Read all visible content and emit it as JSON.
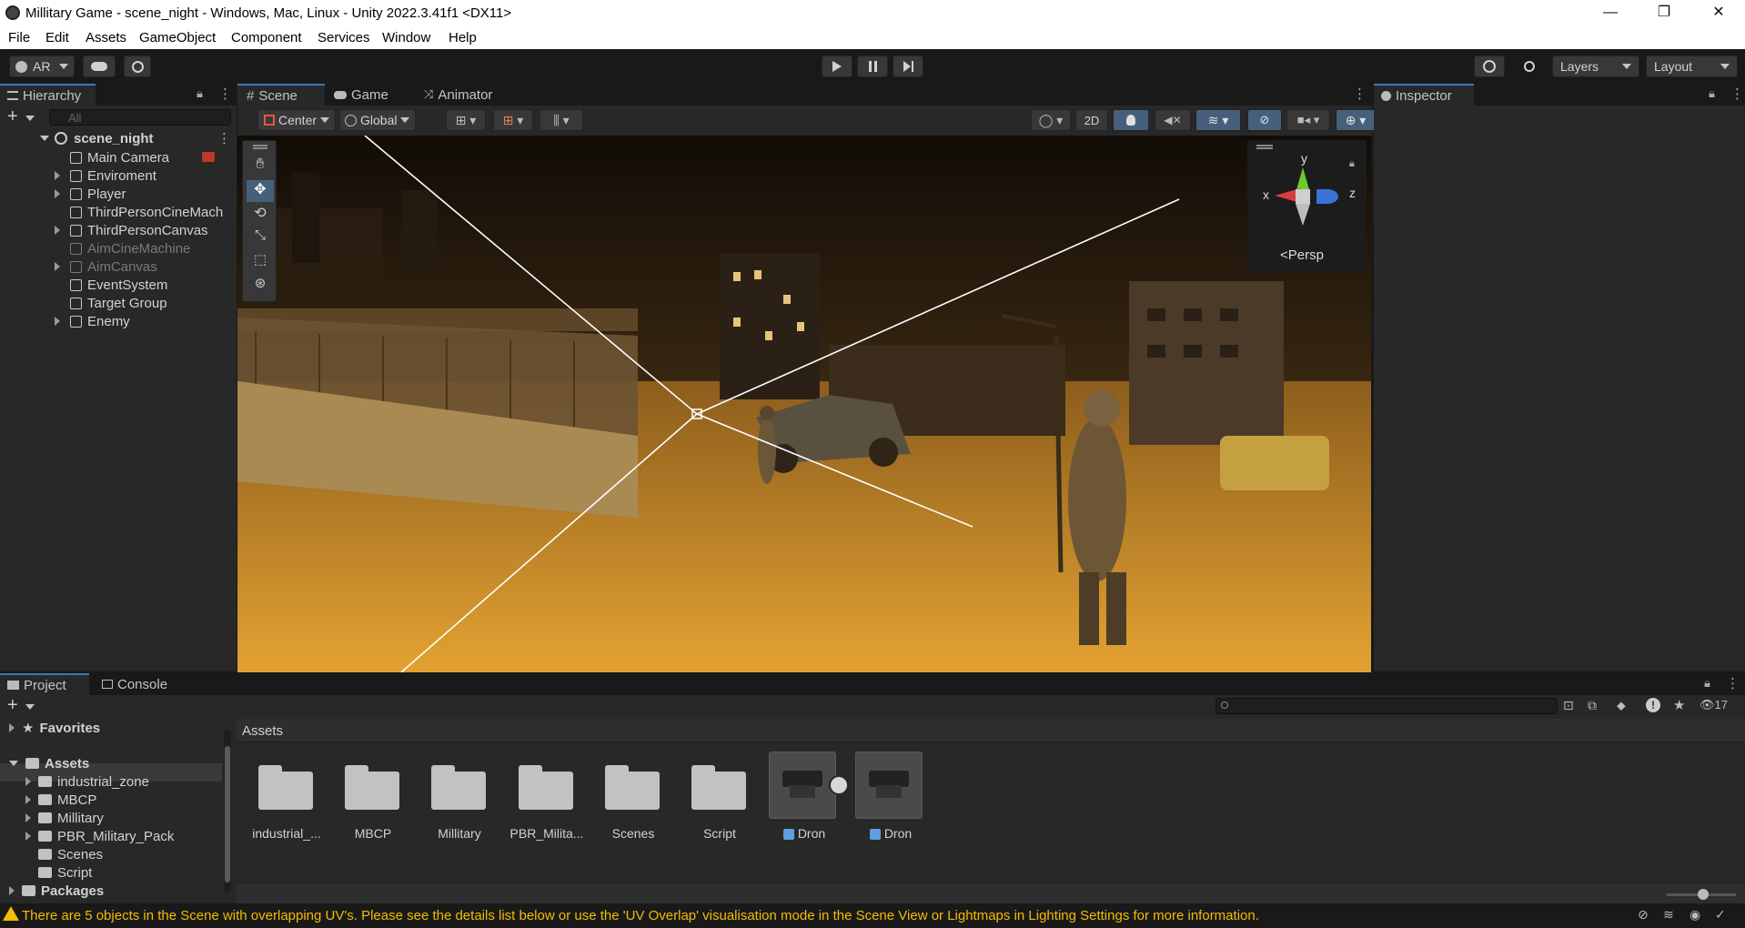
{
  "window": {
    "title": "Millitary Game - scene_night - Windows, Mac, Linux - Unity 2022.3.41f1 <DX11>",
    "minimize": "—",
    "maximize": "❐",
    "close": "✕"
  },
  "menu": [
    "File",
    "Edit",
    "Assets",
    "GameObject",
    "Component",
    "Services",
    "Window",
    "Help"
  ],
  "toolbar": {
    "account": "AR",
    "layers": "Layers",
    "layout": "Layout"
  },
  "hierarchy": {
    "tab": "Hierarchy",
    "search_placeholder": "All",
    "scene": "scene_night",
    "items": [
      {
        "label": "Main Camera",
        "expandable": false,
        "disabled": false
      },
      {
        "label": "Enviroment",
        "expandable": true,
        "disabled": false
      },
      {
        "label": "Player",
        "expandable": true,
        "disabled": false
      },
      {
        "label": "ThirdPersonCineMach",
        "expandable": false,
        "disabled": false
      },
      {
        "label": "ThirdPersonCanvas",
        "expandable": true,
        "disabled": false
      },
      {
        "label": "AimCineMachine",
        "expandable": false,
        "disabled": true
      },
      {
        "label": "AimCanvas",
        "expandable": true,
        "disabled": true
      },
      {
        "label": "EventSystem",
        "expandable": false,
        "disabled": false
      },
      {
        "label": "Target Group",
        "expandable": false,
        "disabled": false
      },
      {
        "label": "Enemy",
        "expandable": true,
        "disabled": false
      }
    ]
  },
  "scene_tabs": {
    "scene": "Scene",
    "game": "Game",
    "animator": "Animator"
  },
  "scene_toolbar": {
    "pivot": "Center",
    "space": "Global",
    "mode2d": "2D"
  },
  "gizmo": {
    "y": "y",
    "x": "x",
    "z": "z",
    "projection": "Persp"
  },
  "inspector": {
    "tab": "Inspector"
  },
  "project": {
    "tab": "Project",
    "console_tab": "Console",
    "breadcrumb": "Assets",
    "hidden_count": "17",
    "tree": {
      "favorites": "Favorites",
      "assets": "Assets",
      "children": [
        "industrial_zone",
        "MBCP",
        "Millitary",
        "PBR_Military_Pack",
        "Scenes",
        "Script"
      ],
      "packages": "Packages"
    },
    "grid": [
      {
        "label": "industrial_...",
        "type": "folder"
      },
      {
        "label": "MBCP",
        "type": "folder"
      },
      {
        "label": "Millitary",
        "type": "folder"
      },
      {
        "label": "PBR_Milita...",
        "type": "folder"
      },
      {
        "label": "Scenes",
        "type": "folder"
      },
      {
        "label": "Script",
        "type": "folder"
      },
      {
        "label": "Dron",
        "type": "prefab"
      },
      {
        "label": "Dron",
        "type": "prefab"
      }
    ]
  },
  "status": {
    "message": "There are 5 objects in the Scene with overlapping UV's. Please see the details list below or use the 'UV Overlap' visualisation mode in the Scene View or Lightmaps in Lighting Settings for more information."
  }
}
